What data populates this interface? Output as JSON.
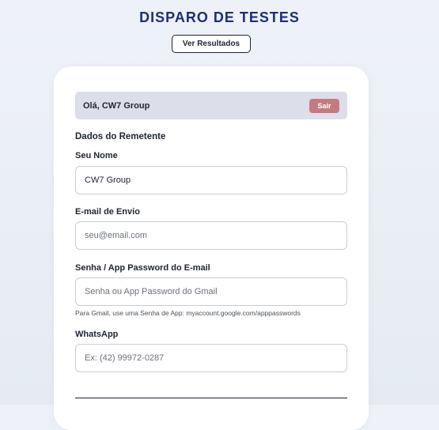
{
  "header": {
    "title": "DISPARO DE TESTES",
    "results_button": "Ver Resultados"
  },
  "session": {
    "greeting": "Olá, CW7 Group",
    "logout_button": "Sair"
  },
  "form": {
    "section_title": "Dados do Remetente",
    "name": {
      "label": "Seu Nome",
      "value": "CW7 Group",
      "placeholder": ""
    },
    "email": {
      "label": "E-mail de Envio",
      "value": "",
      "placeholder": "seu@email.com"
    },
    "password": {
      "label": "Senha / App Password do E-mail",
      "value": "",
      "placeholder": "Senha ou App Password do Gmail",
      "help": "Para Gmail, use uma Senha de App: myaccount.google.com/apppasswords"
    },
    "whatsapp": {
      "label": "WhatsApp",
      "value": "",
      "placeholder": "Ex: (42) 99972-0287"
    }
  },
  "colors": {
    "title": "#1b2f7a",
    "greeting_bar": "#dcdeea",
    "logout_button": "#c47b80",
    "card": "#ffffff"
  }
}
